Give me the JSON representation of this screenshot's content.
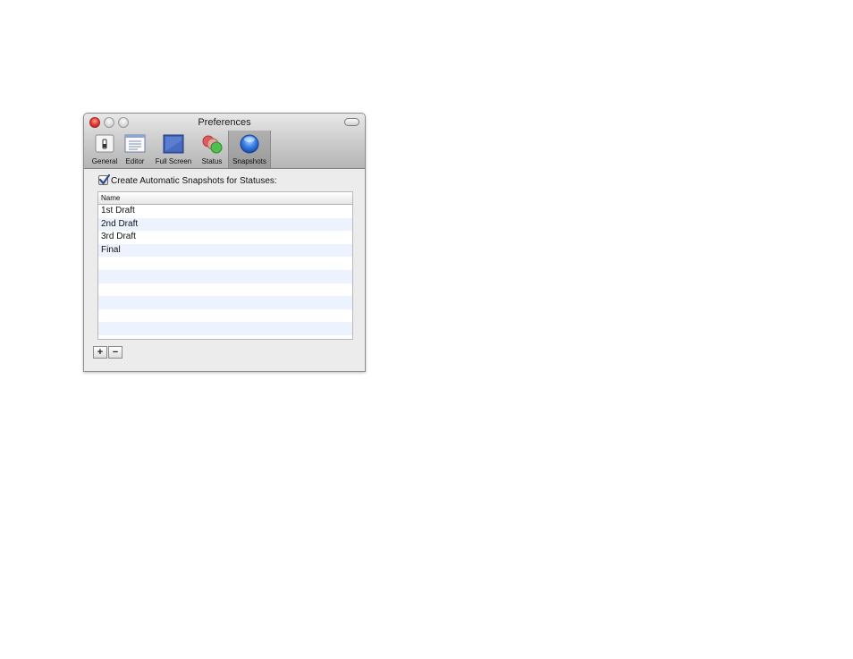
{
  "window": {
    "title": "Preferences"
  },
  "toolbar": {
    "items": [
      {
        "label": "General",
        "icon": "general-switch-icon"
      },
      {
        "label": "Editor",
        "icon": "editor-window-icon"
      },
      {
        "label": "Full Screen",
        "icon": "full-screen-icon"
      },
      {
        "label": "Status",
        "icon": "status-bubbles-icon"
      },
      {
        "label": "Snapshots",
        "icon": "snapshots-orb-icon"
      }
    ],
    "selected": "Snapshots"
  },
  "snapshots": {
    "checkbox_label": "Create Automatic Snapshots for Statuses:",
    "checked": true,
    "table": {
      "column_header": "Name",
      "rows": [
        "1st Draft",
        "2nd Draft",
        "3rd Draft",
        "Final"
      ]
    },
    "add_label": "+",
    "remove_label": "−"
  },
  "colors": {
    "row_stripe": "#edf3fe",
    "close_button": "#e3322c",
    "checkmark": "#2b4a8f"
  }
}
